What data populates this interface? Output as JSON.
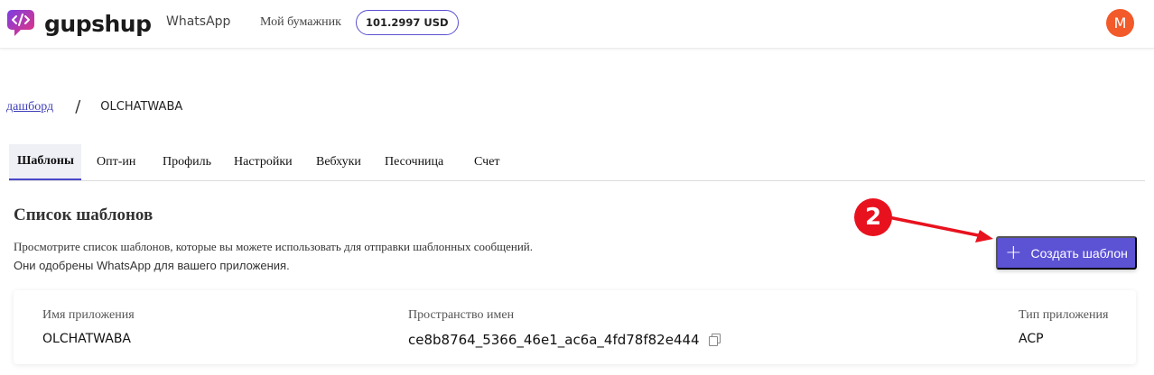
{
  "brand": {
    "name": "gupshup"
  },
  "navbar": {
    "whatsapp_label": "WhatsApp",
    "wallet_label": "Мой бумажник",
    "wallet_balance": "101.2997 USD",
    "avatar_initial": "M"
  },
  "breadcrumb": {
    "root": "дашборд",
    "separator": "/",
    "current": "OLCHATWABA"
  },
  "tabs": [
    {
      "label": "Шаблоны",
      "active": true
    },
    {
      "label": "Опт-ин",
      "active": false
    },
    {
      "label": "Профиль",
      "active": false
    },
    {
      "label": "Настройки",
      "active": false
    },
    {
      "label": "Вебхуки",
      "active": false
    },
    {
      "label": "Песочница",
      "active": false
    },
    {
      "label": "Счет",
      "active": false
    }
  ],
  "templates": {
    "title": "Список шаблонов",
    "description_line1": "Просмотрите список шаблонов, которые вы можете использовать для отправки шаблонных сообщений.",
    "description_line2": "Они одобрены WhatsApp для вашего приложения.",
    "create_button": "Создать шаблон"
  },
  "annotation": {
    "number": "2",
    "color": "#e8121e"
  },
  "app_info": {
    "app_name_label": "Имя приложения",
    "app_name": "OLCHATWABA",
    "namespace_label": "Пространство имен",
    "namespace": "ce8b8764_5366_46e1_ac6a_4fd78f82e444",
    "app_type_label": "Тип приложения",
    "app_type": "ACP"
  },
  "colors": {
    "accent": "#5c52d4",
    "brand_gradient": [
      "#e8327c",
      "#7b3fe4"
    ],
    "avatar": "#f25a29"
  },
  "icons": [
    "gupshup-logo-icon",
    "plus-icon",
    "copy-icon"
  ]
}
